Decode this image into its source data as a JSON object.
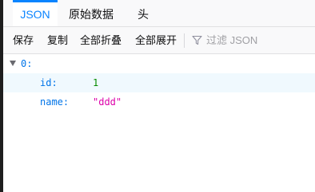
{
  "tabs": [
    {
      "label": "JSON",
      "active": true
    },
    {
      "label": "原始数据",
      "active": false
    },
    {
      "label": "头",
      "active": false
    }
  ],
  "toolbar": {
    "save_label": "保存",
    "copy_label": "复制",
    "collapse_all_label": "全部折叠",
    "expand_all_label": "全部展开",
    "filter_placeholder": "过滤 JSON",
    "filter_icon": "filter-icon"
  },
  "tree": {
    "root": {
      "key": "0:",
      "expanded": true
    },
    "rows": [
      {
        "key": "id:",
        "value": "1",
        "type": "number"
      },
      {
        "key": "name:",
        "value": "\"ddd\"",
        "type": "string"
      }
    ]
  },
  "colors": {
    "accent": "#0a84ff",
    "key": "#0074e8",
    "number": "#058b00",
    "string": "#dd00a9",
    "row_highlight": "#f0f9fe"
  }
}
